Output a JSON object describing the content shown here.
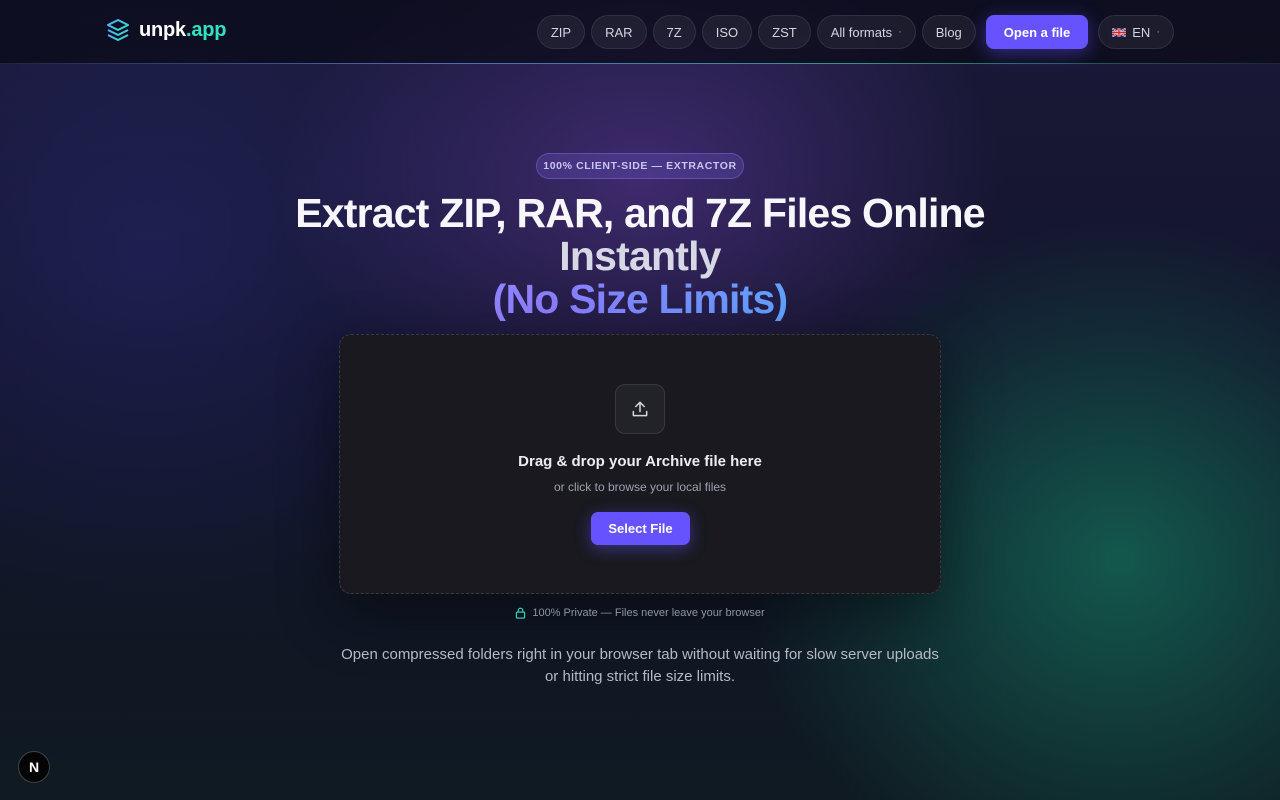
{
  "header": {
    "logo": {
      "name_part1": "unpk",
      "name_part2": ".app",
      "icon": "stack-layers-icon"
    },
    "nav": {
      "formats": [
        "ZIP",
        "RAR",
        "7Z",
        "ISO",
        "ZST"
      ],
      "all_formats_label": "All formats",
      "blog_label": "Blog",
      "open_file_label": "Open a file",
      "language_label": "EN",
      "language_flag": "uk-flag-icon",
      "dropdown_marker": "·"
    }
  },
  "hero": {
    "badge": "100% CLIENT-SIDE — EXTRACTOR",
    "title_line1": "Extract ZIP, RAR, and 7Z Files Online",
    "title_line2": "Instantly",
    "title_line3": "(No Size Limits)"
  },
  "dropzone": {
    "icon": "upload-icon",
    "title": "Drag & drop your Archive file here",
    "subtitle": "or click to browse your local files",
    "button_label": "Select File"
  },
  "privacy_note": "100% Private — Files never leave your browser",
  "description": "Open compressed folders right in your browser tab without waiting for slow server uploads or hitting strict file size limits.",
  "corner_button_label": "N",
  "colors": {
    "accent": "#6653ff",
    "teal": "#2fe3c0",
    "background": "#121329"
  }
}
